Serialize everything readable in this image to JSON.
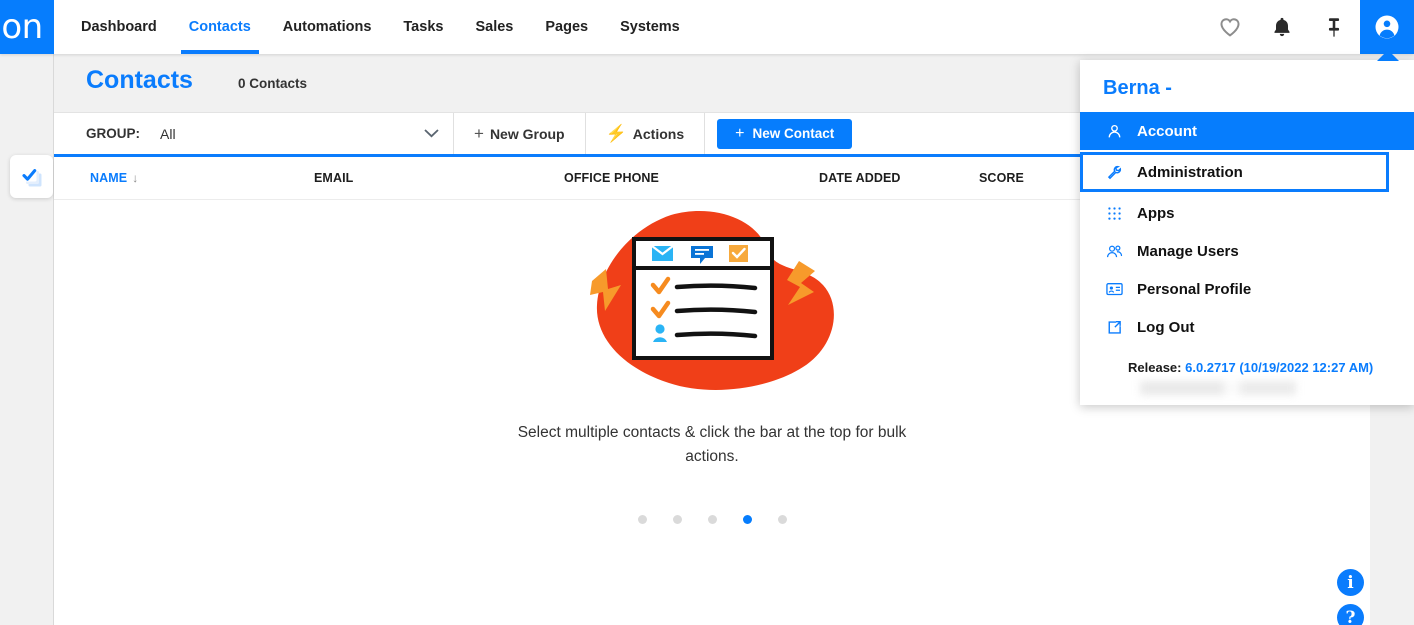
{
  "brand": {
    "logo_text": "on",
    "accent": "#067dfd"
  },
  "topnav": {
    "items": [
      {
        "label": "Dashboard",
        "active": false
      },
      {
        "label": "Contacts",
        "active": true
      },
      {
        "label": "Automations",
        "active": false
      },
      {
        "label": "Tasks",
        "active": false
      },
      {
        "label": "Sales",
        "active": false
      },
      {
        "label": "Pages",
        "active": false
      },
      {
        "label": "Systems",
        "active": false
      }
    ],
    "icons": [
      {
        "name": "heart-icon"
      },
      {
        "name": "bell-icon"
      },
      {
        "name": "pin-icon"
      },
      {
        "name": "account-avatar-icon"
      }
    ]
  },
  "page": {
    "title": "Contacts",
    "count_label": "0 Contacts"
  },
  "toolbar": {
    "group_label": "GROUP:",
    "group_value": "All",
    "new_group_label": "New Group",
    "actions_label": "Actions",
    "new_contact_label": "New Contact",
    "plus_glyph": "+",
    "bolt_glyph": "⚡"
  },
  "table": {
    "columns": [
      "NAME",
      "EMAIL",
      "OFFICE PHONE",
      "DATE ADDED",
      "SCORE"
    ],
    "sort_glyph": "↓",
    "rows": []
  },
  "empty_state": {
    "message": "Select multiple contacts & click the bar at the top for bulk actions.",
    "carousel": {
      "count": 5,
      "active_index": 3
    }
  },
  "account_menu": {
    "title": "Berna -",
    "items": [
      {
        "label": "Account",
        "icon": "person-icon",
        "state": "selected"
      },
      {
        "label": "Administration",
        "icon": "wrench-icon",
        "state": "focused"
      },
      {
        "label": "Apps",
        "icon": "grid-dots-icon",
        "state": "normal"
      },
      {
        "label": "Manage Users",
        "icon": "users-icon",
        "state": "normal"
      },
      {
        "label": "Personal Profile",
        "icon": "id-card-icon",
        "state": "normal"
      },
      {
        "label": "Log Out",
        "icon": "logout-icon",
        "state": "normal"
      }
    ],
    "release_label": "Release:",
    "release_value": "6.0.2717 (10/19/2022 12:27 AM)"
  },
  "help": {
    "info_glyph": "i",
    "question_glyph": "?"
  }
}
